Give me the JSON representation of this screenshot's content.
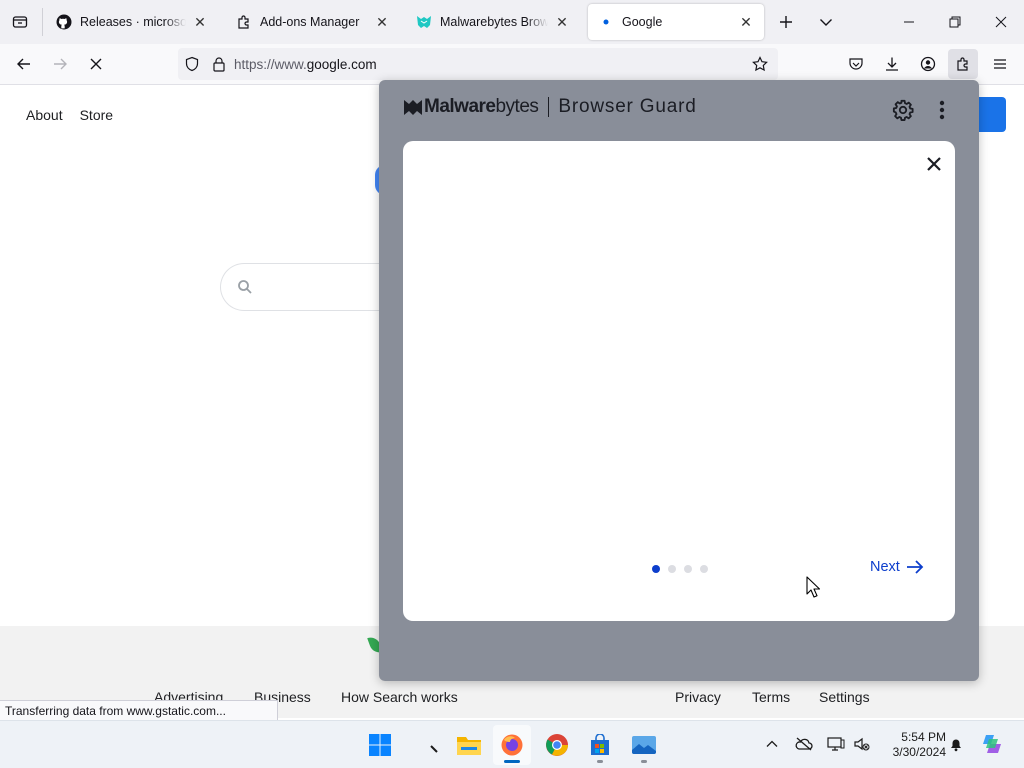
{
  "tabs": [
    {
      "title": "Releases · microsoft/PowerToys",
      "icon": "github-icon"
    },
    {
      "title": "Add-ons Manager",
      "icon": "puzzle-icon"
    },
    {
      "title": "Malwarebytes Browser Guard",
      "icon": "malwarebytes-icon"
    },
    {
      "title": "Google",
      "icon": "loading-dot-icon",
      "active": true
    }
  ],
  "urlbar": {
    "scheme": "https://www.",
    "host": "google.com"
  },
  "google": {
    "nav": [
      "About",
      "Store"
    ],
    "footer": {
      "left": [
        "Advertising",
        "Business",
        "How Search works"
      ],
      "right": [
        "Privacy",
        "Terms",
        "Settings"
      ]
    }
  },
  "status_text": "Transferring data from www.gstatic.com...",
  "malwarebytes": {
    "brand_bold": "Malware",
    "brand_light": "bytes",
    "product": "Browser Guard",
    "onboarding": {
      "page_count": 4,
      "current_page": 1,
      "next_label": "Next"
    }
  },
  "clock": {
    "time": "5:54 PM",
    "date": "3/30/2024"
  },
  "colors": {
    "panel_bg": "#898e99",
    "accent_blue": "#0d3ecc",
    "google_blue": "#1a73e8"
  }
}
